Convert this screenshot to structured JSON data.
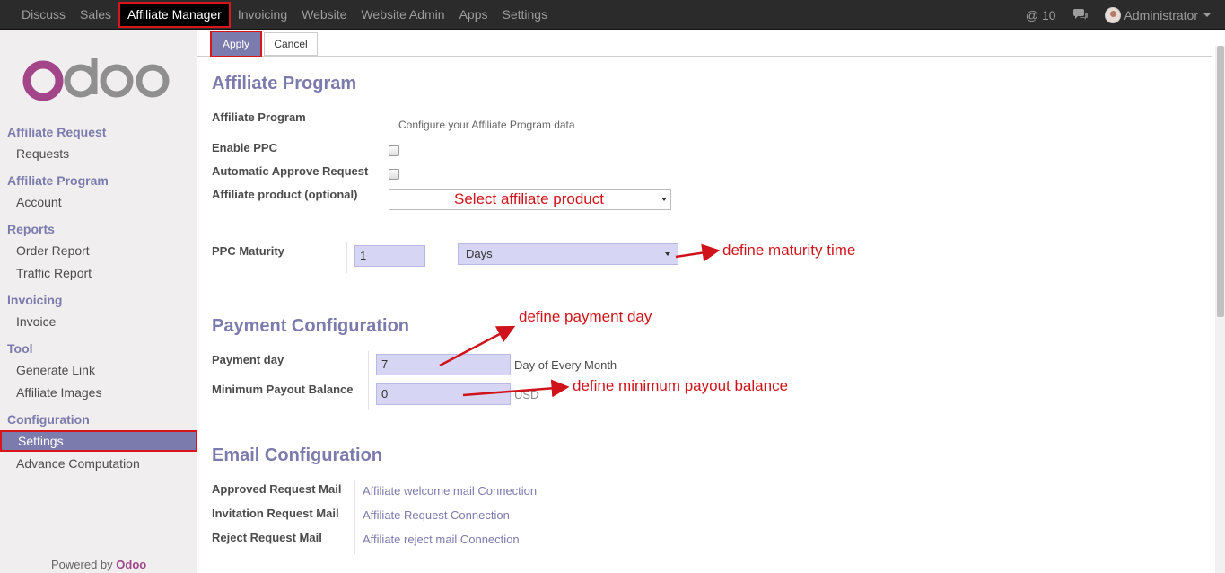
{
  "navbar": {
    "menu": [
      "Discuss",
      "Sales",
      "Affiliate Manager",
      "Invoicing",
      "Website",
      "Website Admin",
      "Apps",
      "Settings"
    ],
    "active_menu": "Affiliate Manager",
    "mentions": "@ 10",
    "user": "Administrator"
  },
  "sidebar": {
    "logo_text": "odoo",
    "sections": [
      {
        "title": "Affiliate Request",
        "items": [
          "Requests"
        ]
      },
      {
        "title": "Affiliate Program",
        "items": [
          "Account"
        ]
      },
      {
        "title": "Reports",
        "items": [
          "Order Report",
          "Traffic Report"
        ]
      },
      {
        "title": "Invoicing",
        "items": [
          "Invoice"
        ]
      },
      {
        "title": "Tool",
        "items": [
          "Generate Link",
          "Affiliate Images"
        ]
      },
      {
        "title": "Configuration",
        "items": [
          "Settings",
          "Advance Computation"
        ]
      }
    ],
    "active_item": "Settings",
    "powered_prefix": "Powered by",
    "powered_brand": "Odoo"
  },
  "buttons": {
    "apply": "Apply",
    "cancel": "Cancel"
  },
  "affiliate_program": {
    "title": "Affiliate Program",
    "row_label": "Affiliate Program",
    "row_value": "Configure your Affiliate Program data",
    "enable_ppc_label": "Enable PPC",
    "auto_approve_label": "Automatic Approve Request",
    "product_label": "Affiliate product (optional)",
    "product_placeholder": "Select affiliate product",
    "ppc_maturity_label": "PPC Maturity",
    "ppc_maturity_value": "1",
    "ppc_maturity_unit": "Days"
  },
  "payment": {
    "title": "Payment Configuration",
    "payment_day_label": "Payment day",
    "payment_day_value": "7",
    "payment_day_suffix": "Day of Every Month",
    "min_payout_label": "Minimum Payout Balance",
    "min_payout_value": "0",
    "min_payout_currency": "USD"
  },
  "email": {
    "title": "Email Configuration",
    "rows": [
      {
        "label": "Approved Request Mail",
        "value": "Affiliate welcome mail Connection"
      },
      {
        "label": "Invitation Request Mail",
        "value": "Affiliate Request Connection"
      },
      {
        "label": "Reject Request Mail",
        "value": "Affiliate reject mail Connection"
      }
    ]
  },
  "annotations": {
    "maturity": "define maturity time",
    "payment_day": "define payment day",
    "min_payout": "define minimum payout balance",
    "color": "#d0131a"
  }
}
